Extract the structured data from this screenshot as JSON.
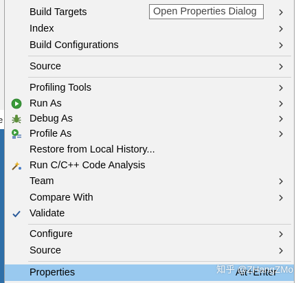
{
  "background": {
    "partial_text": "e"
  },
  "menu": {
    "items": [
      {
        "label": "Build Targets",
        "submenu": true
      },
      {
        "label": "Index",
        "submenu": true
      },
      {
        "label": "Build Configurations",
        "submenu": true
      },
      {
        "label": "Source",
        "submenu": true
      },
      {
        "label": "Profiling Tools",
        "submenu": true
      },
      {
        "label": "Run As",
        "submenu": true,
        "icon": "run-icon"
      },
      {
        "label": "Debug As",
        "submenu": true,
        "icon": "debug-icon"
      },
      {
        "label": "Profile As",
        "submenu": true,
        "icon": "profile-icon"
      },
      {
        "label": "Restore from Local History...",
        "submenu": false
      },
      {
        "label": "Run C/C++ Code Analysis",
        "submenu": false,
        "icon": "code-analysis-icon"
      },
      {
        "label": "Team",
        "submenu": true
      },
      {
        "label": "Compare With",
        "submenu": true
      },
      {
        "label": "Validate",
        "submenu": false,
        "icon": "checkmark-icon"
      },
      {
        "label": "Configure",
        "submenu": true
      },
      {
        "label": "Source",
        "submenu": true
      },
      {
        "label": "Properties",
        "submenu": false,
        "shortcut": "Alt+Enter",
        "highlighted": true
      }
    ]
  },
  "tooltip": {
    "text": "Open Properties Dialog"
  },
  "watermark": {
    "text": "知乎 @ZHangZMo"
  },
  "colors": {
    "menu_bg": "#f2f2f2",
    "highlight": "#99c9ef",
    "separator": "#d0d0d0",
    "run_green": "#3a9a3a",
    "background_blue": "#2f6fa8"
  }
}
